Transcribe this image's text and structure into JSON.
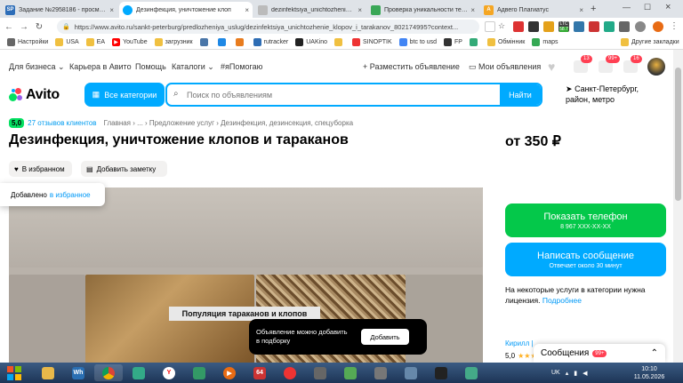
{
  "browser": {
    "tabs": [
      {
        "title": "Задание №2958186 - просмотр з",
        "icon": "SP",
        "color": "#2c6db8"
      },
      {
        "title": "Дезинфекция, уничтожение клоп",
        "icon": "avito",
        "color": "#00aaff"
      },
      {
        "title": "dezinfektsiya_unichtozhenie_kl",
        "icon": "doc",
        "color": "#999999"
      },
      {
        "title": "Проверка уникальности текста",
        "icon": "check",
        "color": "#3aa757"
      },
      {
        "title": "Адвего Плагиатус",
        "icon": "A",
        "color": "#f5a623"
      }
    ],
    "url": "https://www.avito.ru/sankt-peterburg/predlozheniya_uslug/dezinfektsiya_unichtozhenie_klopov_i_tarakanov_802174995?context...",
    "bookmarks": [
      "Настройки",
      "USA",
      "EA",
      "YouTube",
      "загрузник",
      "",
      "",
      "",
      "rutracker",
      "UAKino",
      "",
      "SINOPTIK",
      "btc to usd",
      "FP",
      "",
      "Обмінник",
      "maps"
    ],
    "bookmarks_other": "Другие закладки",
    "ext_badges": {
      "ltc": "LTC",
      "ltc_val": "58.7",
      "count": "98"
    }
  },
  "avito": {
    "toplinks": [
      "Для бизнеса",
      "Карьера в Авито",
      "Помощь",
      "Каталоги",
      "#яПомогаю"
    ],
    "post_ad": "+ Разместить объявление",
    "my_ads": "Мои объявления",
    "badges": {
      "fav": "",
      "notif": "13",
      "msg": "99+",
      "cart": "16"
    },
    "logo": "Avito",
    "categories_btn": "Все категории",
    "search_placeholder": "Поиск по объявлениям",
    "find_btn": "Найти",
    "city": "Санкт-Петербург,",
    "city_sub": "район, метро",
    "rating": "5,0",
    "reviews": "27 отзывов клиентов",
    "breadcrumbs": [
      "Главная",
      "...",
      "Предложение услуг",
      "Дезинфекция, дезинсекция, спецуборка"
    ],
    "title": "Дезинфекция, уничтожение клопов и тараканов",
    "price": "от 350 ₽",
    "chip_fav": "В избранном",
    "chip_note": "Добавить заметку",
    "toast_fav": "Добавлено",
    "toast_fav_link": "в избранное",
    "image_caption": "Популяция тараканов и клопов",
    "show_phone": "Показать телефон",
    "phone_sub": "8 967 XXX-XX-XX",
    "write_msg": "Написать сообщение",
    "msg_sub": "Отвечает около 30 минут",
    "license_text": "На некоторые услуги в категории нужна лицензия.",
    "license_link": "Подробнее",
    "seller_name": "Кирилл |",
    "seller_rating": "5,0",
    "stars": "★★★",
    "toast_add": "Объявление можно добавить в подборку",
    "toast_add_btn": "Добавить",
    "messages_bar": "Сообщения",
    "messages_badge": "99+"
  },
  "taskbar": {
    "apps": [
      "Wh",
      "",
      "",
      "Y",
      "",
      "",
      "64",
      "",
      "",
      "",
      "",
      "",
      "",
      ""
    ],
    "lang": "UK",
    "time": "10:10",
    "date": "11.05.2026"
  }
}
